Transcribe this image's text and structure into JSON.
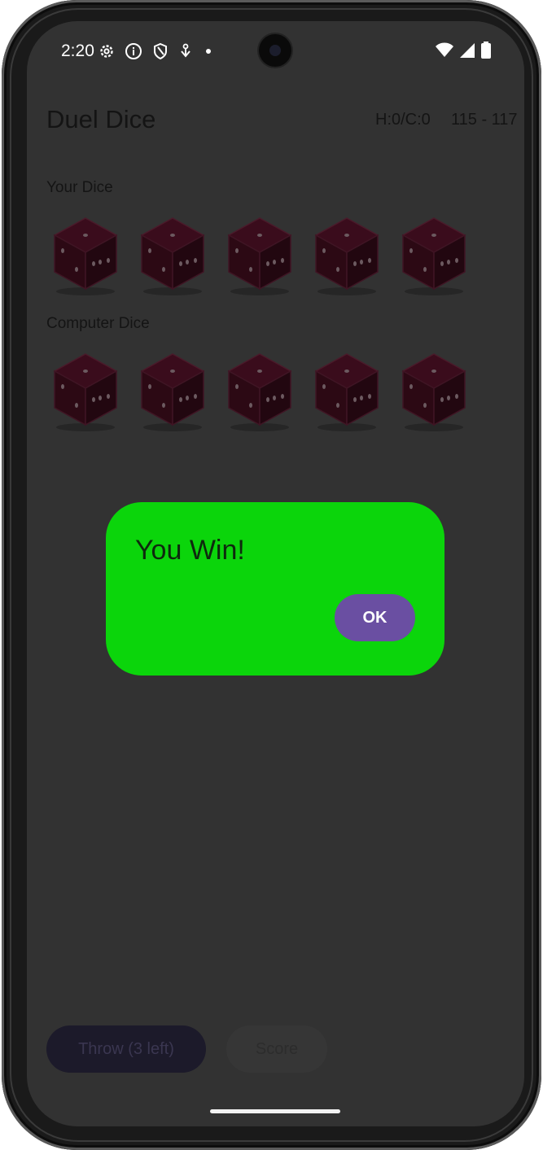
{
  "status_bar": {
    "time": "2:20",
    "left_icons": [
      "gear-icon",
      "info-icon",
      "shield-icon",
      "download-icon",
      "dot-icon"
    ],
    "right_icons": [
      "wifi-icon",
      "signal-icon",
      "battery-icon"
    ]
  },
  "app": {
    "title": "Duel Dice",
    "hc_score": "H:0/C:0",
    "total_score": "115 - 117"
  },
  "your_dice": {
    "label": "Your Dice",
    "dice": [
      "die-icon",
      "die-icon",
      "die-icon",
      "die-icon",
      "die-icon"
    ]
  },
  "computer_dice": {
    "label": "Computer Dice",
    "dice": [
      "die-icon",
      "die-icon",
      "die-icon",
      "die-icon",
      "die-icon"
    ]
  },
  "dialog": {
    "message": "You Win!",
    "ok_label": "OK"
  },
  "actions": {
    "throw_label": "Throw (3 left)",
    "score_label": "Score"
  },
  "colors": {
    "screen_bg": "#323232",
    "dialog_bg": "#0bd50b",
    "ok_button": "#6a4fa2",
    "die_color": "#2a0a14"
  }
}
